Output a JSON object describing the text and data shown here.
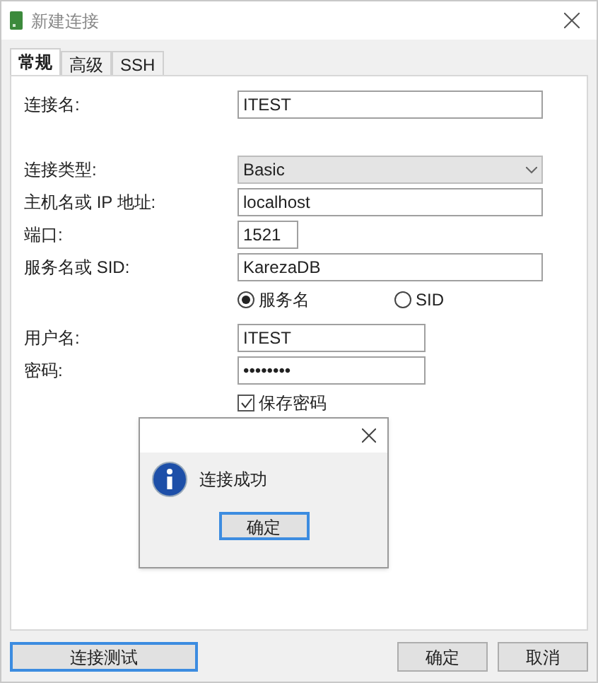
{
  "window": {
    "title": "新建连接"
  },
  "tabs": [
    {
      "label": "常规",
      "selected": true
    },
    {
      "label": "高级",
      "selected": false
    },
    {
      "label": "SSH",
      "selected": false
    }
  ],
  "form": {
    "connection_name": {
      "label": "连接名:",
      "value": "ITEST"
    },
    "connection_type": {
      "label": "连接类型:",
      "value": "Basic"
    },
    "host": {
      "label": "主机名或 IP 地址:",
      "value": "localhost"
    },
    "port": {
      "label": "端口:",
      "value": "1521"
    },
    "service": {
      "label": "服务名或 SID:",
      "value": "KarezaDB"
    },
    "service_options": [
      {
        "label": "服务名",
        "selected": true
      },
      {
        "label": "SID",
        "selected": false
      }
    ],
    "username": {
      "label": "用户名:",
      "value": "ITEST"
    },
    "password": {
      "label": "密码:",
      "value": "••••••••"
    },
    "save_password": {
      "label": "保存密码",
      "checked": true
    }
  },
  "message_box": {
    "message": "连接成功",
    "button": "确定"
  },
  "buttons": {
    "test": "连接测试",
    "ok": "确定",
    "cancel": "取消"
  }
}
